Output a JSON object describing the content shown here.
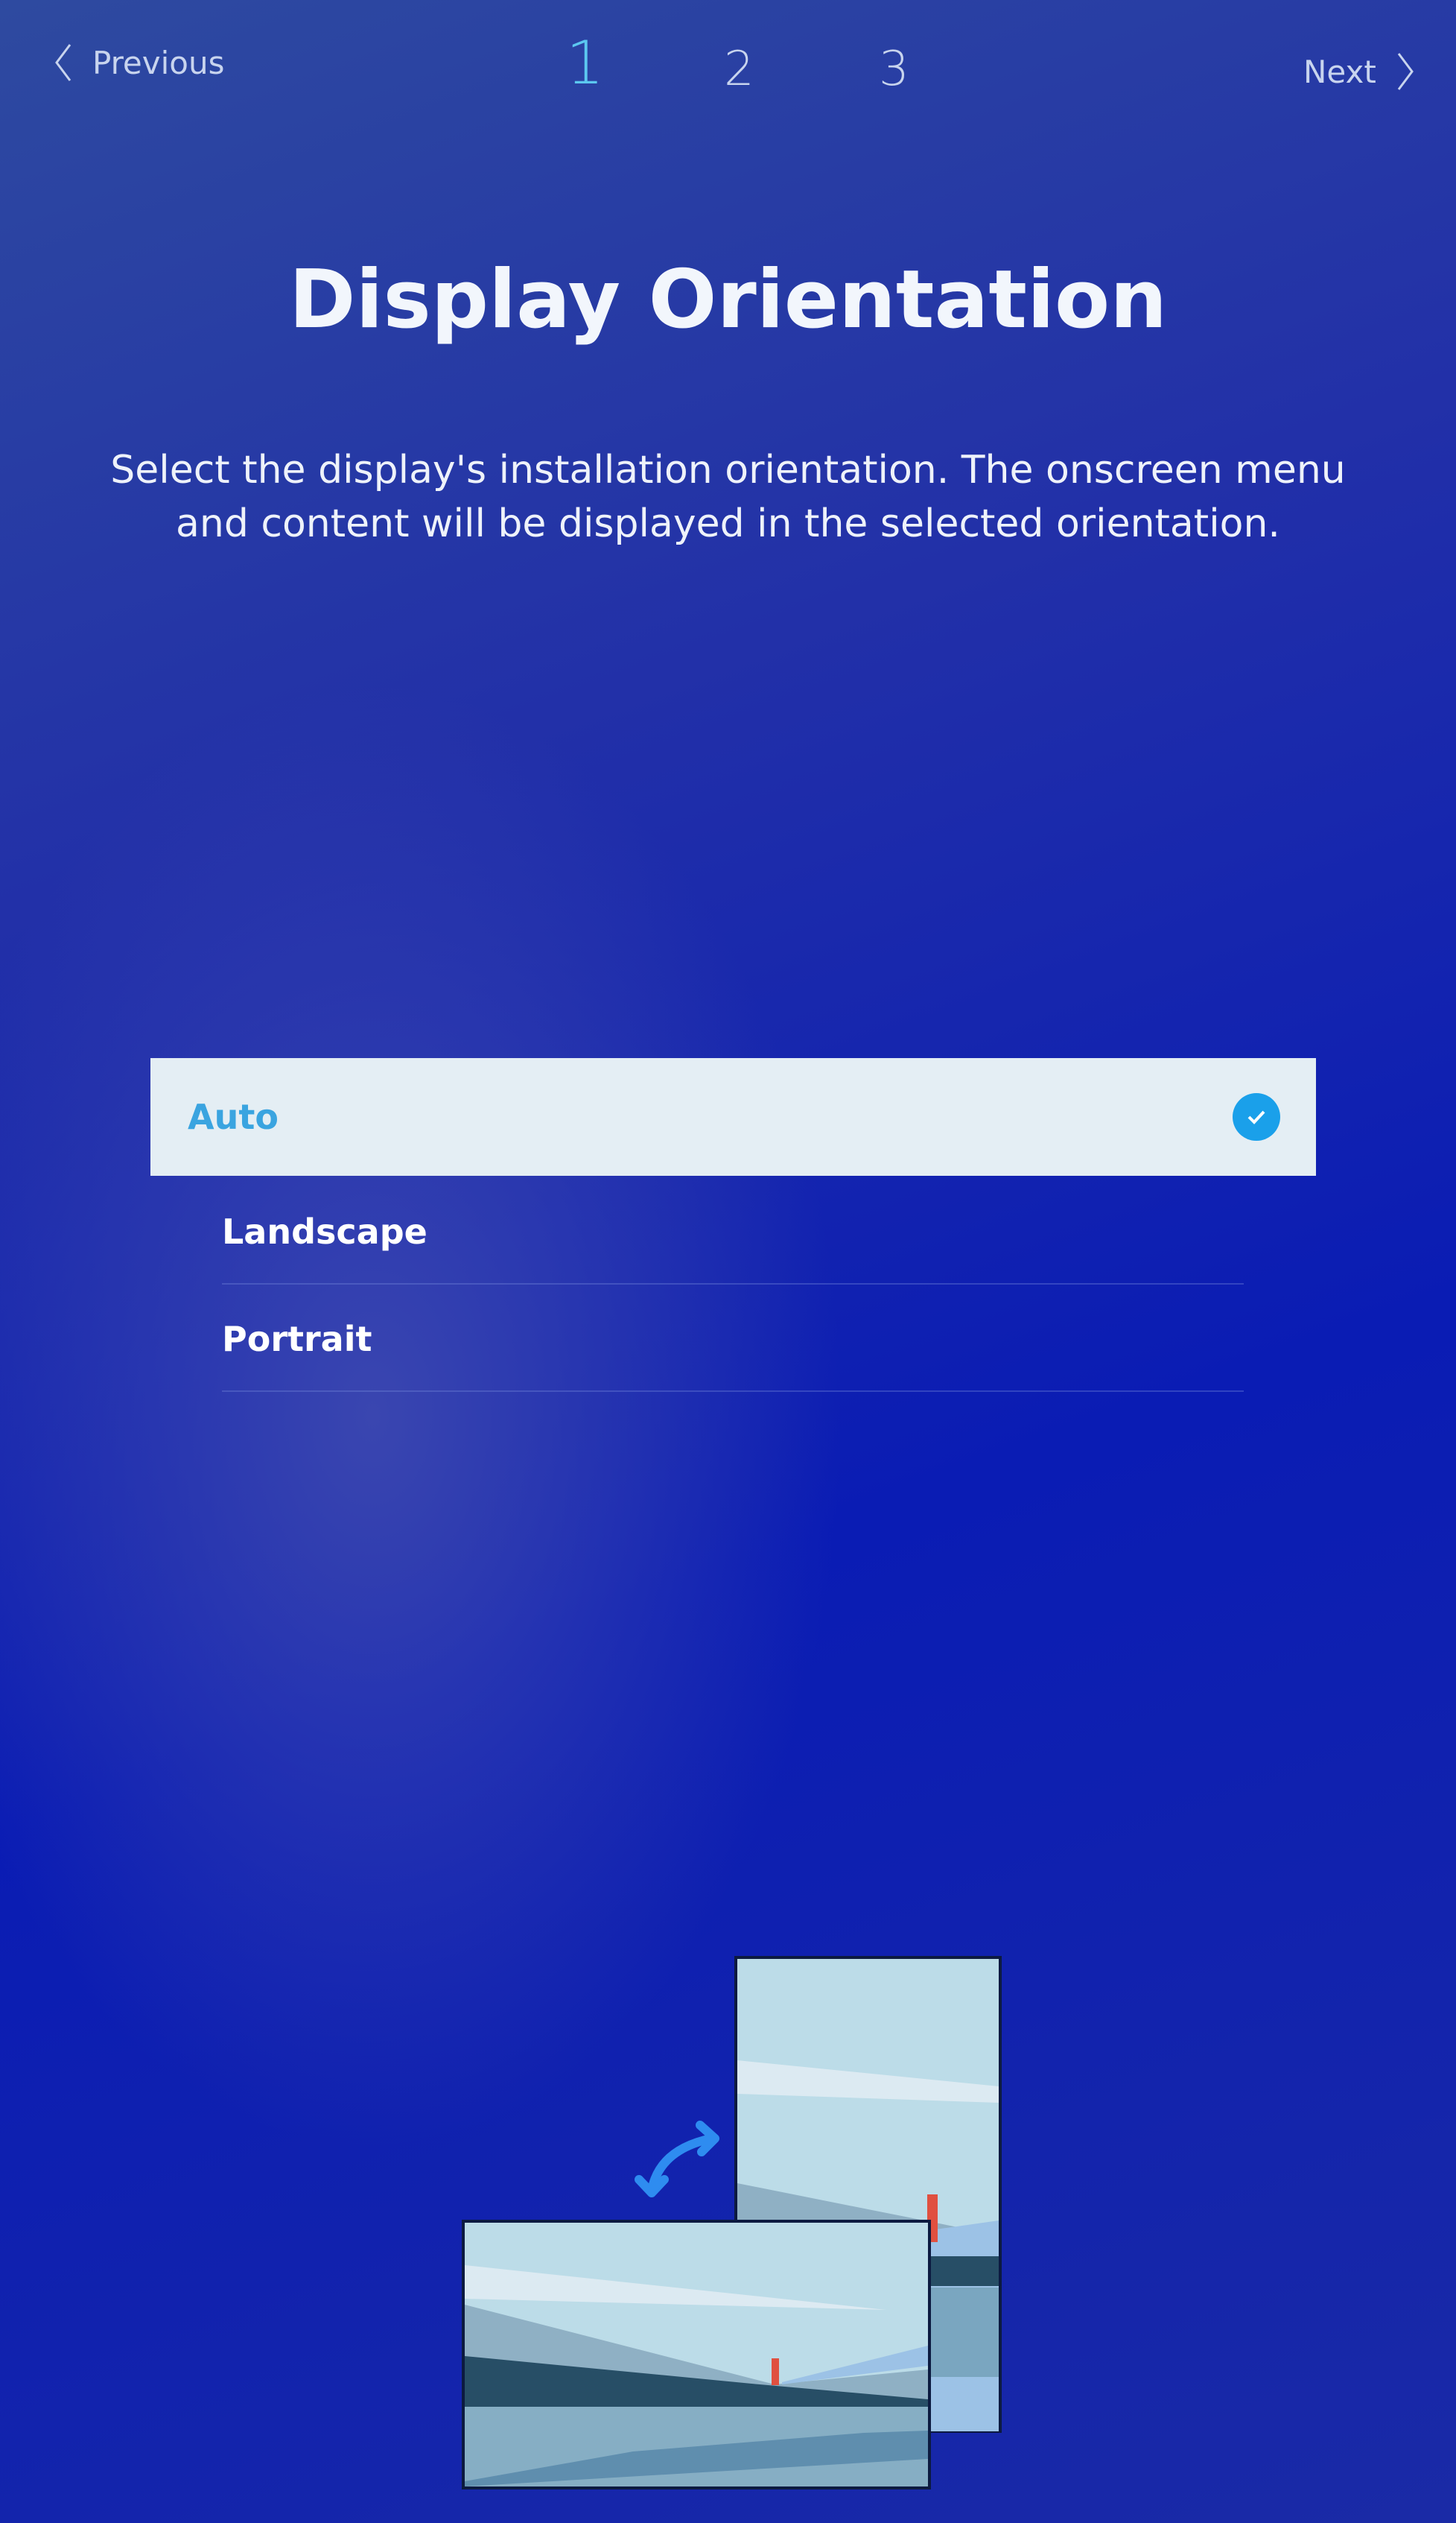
{
  "nav": {
    "previous_label": "Previous",
    "next_label": "Next",
    "steps": [
      "1",
      "2",
      "3"
    ],
    "current_step": "1"
  },
  "title": "Display Orientation",
  "description": {
    "line1": "Select the display's installation orientation. The onscreen menu",
    "line2": "and content will be displayed in the selected orientation."
  },
  "options": [
    {
      "label": "Auto",
      "selected": true
    },
    {
      "label": "Landscape",
      "selected": false
    },
    {
      "label": "Portrait",
      "selected": false
    }
  ],
  "colors": {
    "accent": "#1aa0ea",
    "selected_text": "#3aa4e0",
    "background": "#1a2aa6"
  }
}
